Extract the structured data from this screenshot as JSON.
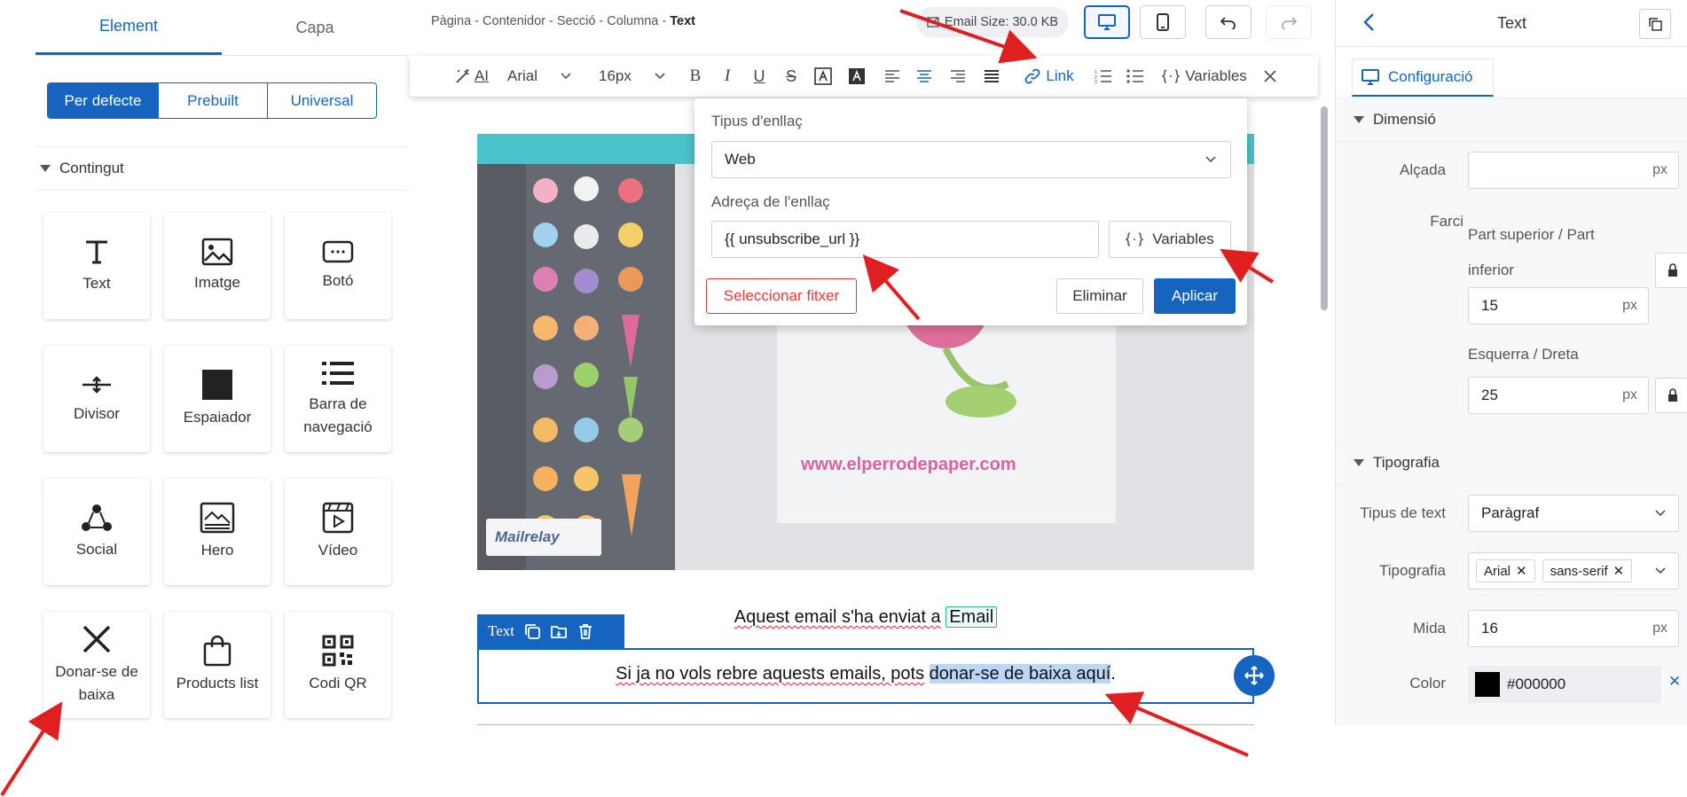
{
  "left": {
    "tabs": [
      "Element",
      "Capa"
    ],
    "segments": [
      "Per defecte",
      "Prebuilt",
      "Universal"
    ],
    "section": "Contingut",
    "cards": [
      {
        "label": "Text",
        "icon": "text-icon"
      },
      {
        "label": "Imatge",
        "icon": "image-icon"
      },
      {
        "label": "Botó",
        "icon": "button-icon"
      },
      {
        "label": "Divisor",
        "icon": "divider-icon"
      },
      {
        "label": "Espaiador",
        "icon": "spacer-icon"
      },
      {
        "label": "Barra de navegació",
        "icon": "navbar-icon"
      },
      {
        "label": "Social",
        "icon": "social-icon"
      },
      {
        "label": "Hero",
        "icon": "hero-icon"
      },
      {
        "label": "Vídeo",
        "icon": "video-icon"
      },
      {
        "label": "Donar-se de baixa",
        "icon": "close-icon"
      },
      {
        "label": "Products list",
        "icon": "shopping-bag-icon"
      },
      {
        "label": "Codi QR",
        "icon": "qr-code-icon"
      }
    ]
  },
  "center": {
    "breadcrumb": [
      "Pàgina",
      "Contenidor",
      "Secció",
      "Columna",
      "Text"
    ],
    "email_size": "Email Size: 30.0 KB",
    "toolbar": {
      "ai": "AI",
      "font": "Arial",
      "size": "16px",
      "link": "Link",
      "variables": "Variables"
    },
    "popup": {
      "type_label": "Tipus d'enllaç",
      "type_value": "Web",
      "address_label": "Adreça de l'enllaç",
      "address_value": "{{ unsubscribe_url }}",
      "variables": "Variables",
      "select_file": "Seleccionar fitxer",
      "delete": "Eliminar",
      "apply": "Aplicar"
    },
    "email": {
      "canva_url": "www.elperrodepaper.com",
      "line1_prefix": "Aquest email s'ha enviat a",
      "line1_chip": "Email",
      "line2_prefix": "Si ja no vols rebre aquests emails, pots",
      "line2_link": "donar-se de baixa aquí",
      "line2_suffix": "."
    },
    "text_bar_label": "Text"
  },
  "right": {
    "title": "Text",
    "config_tab": "Configuració",
    "dimension": {
      "title": "Dimensió",
      "height_label": "Alçada",
      "height_value": "",
      "unit": "px",
      "padding_label": "Farci",
      "tb_label": "Part superior / Part inferior",
      "tb_value": "15",
      "lr_label": "Esquerra / Dreta",
      "lr_value": "25"
    },
    "typography": {
      "title": "Tipografia",
      "type_label": "Tipus de text",
      "type_value": "Paràgraf",
      "font_label": "Tipografia",
      "font_chips": [
        "Arial",
        "sans-serif"
      ],
      "size_label": "Mida",
      "size_value": "16",
      "color_label": "Color",
      "color_value": "#000000"
    }
  },
  "colors": {
    "accent": "#1565c0",
    "danger": "#e53935",
    "annotation": "#e02020"
  }
}
